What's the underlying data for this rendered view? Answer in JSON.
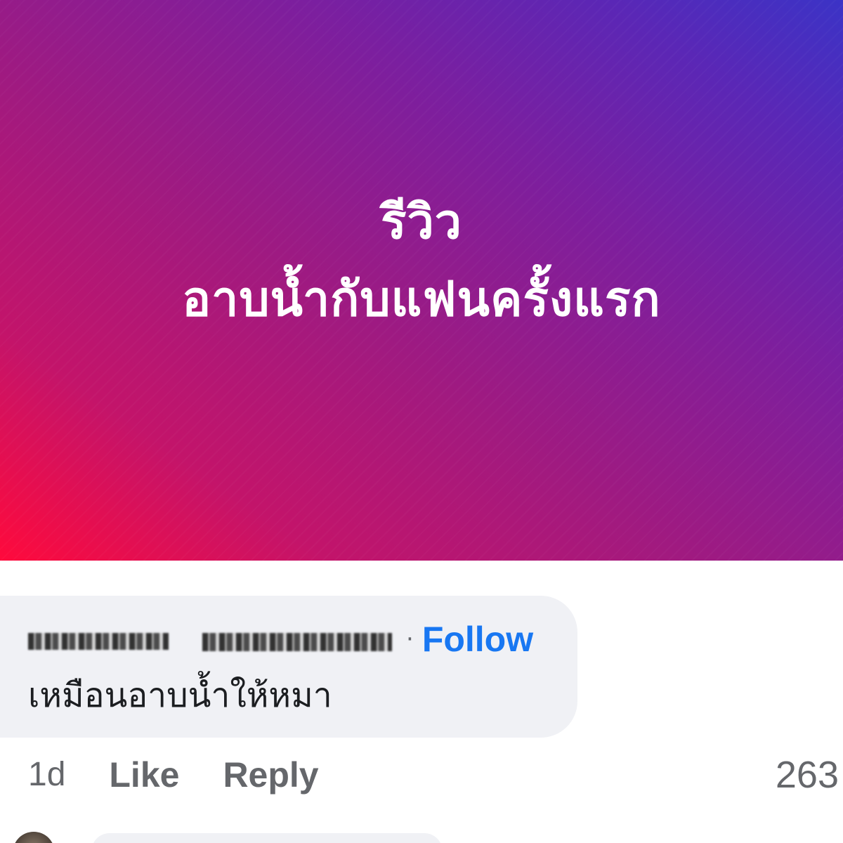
{
  "post": {
    "title_line1": "รีวิว",
    "title_line2": "อาบน้ำกับแฟนครั้งแรก",
    "gradient_colors": [
      "#ff0a3c",
      "#a01a80",
      "#3b33c6"
    ]
  },
  "comment": {
    "author_redacted": true,
    "separator": "·",
    "follow_label": "Follow",
    "text": "เหมือนอาบน้ำให้หมา",
    "time_ago": "1d",
    "like_label": "Like",
    "reply_label": "Reply",
    "reaction_count": "263"
  },
  "colors": {
    "link_blue": "#1877f2",
    "muted_gray": "#65676b",
    "bubble_bg": "#f0f1f5",
    "text_dark": "#1c1e21"
  }
}
